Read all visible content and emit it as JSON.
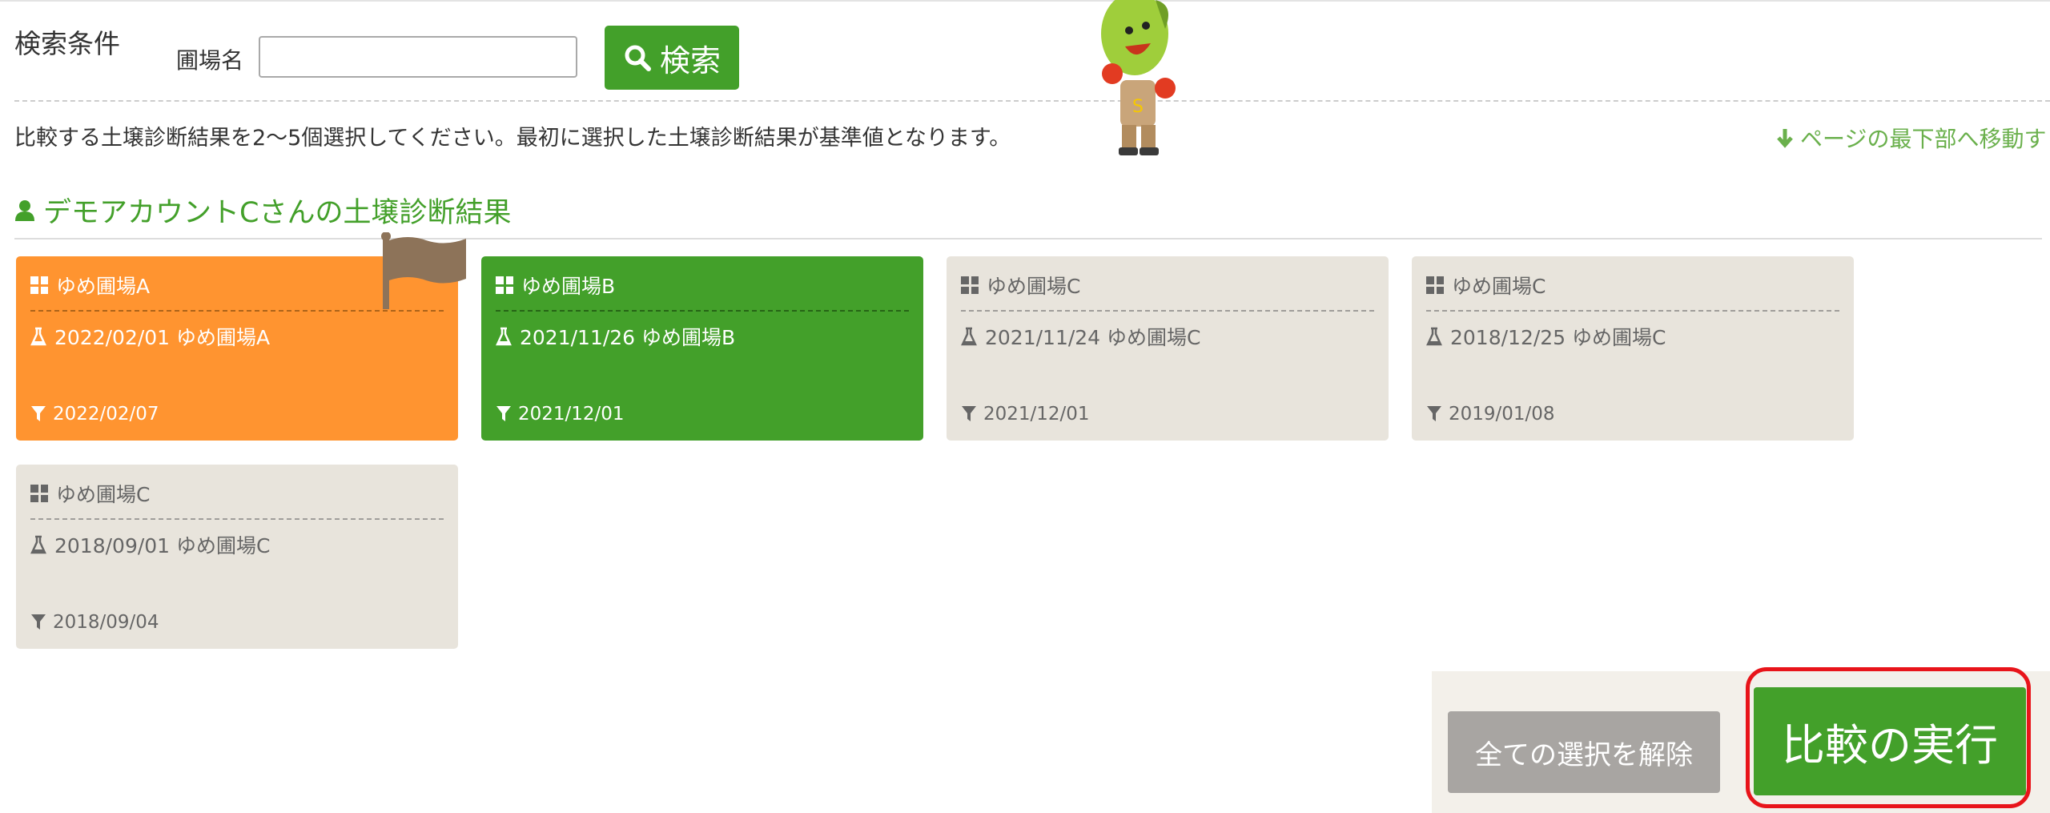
{
  "search": {
    "heading": "検索条件",
    "field_label": "圃場名",
    "input_value": "",
    "button_label": "検索"
  },
  "instruction": "比較する土壌診断結果を2〜5個選択してください。最初に選択した土壌診断結果が基準値となります。",
  "jump_link": "ページの最下部へ移動す",
  "owner_heading": "デモアカウントCさんの土壌診断結果",
  "cards": [
    {
      "field": "ゆめ圃場A",
      "diagnosis": "2022/02/01 ゆめ圃場A",
      "date": "2022/02/07",
      "state": "selected-first"
    },
    {
      "field": "ゆめ圃場B",
      "diagnosis": "2021/11/26 ゆめ圃場B",
      "date": "2021/12/01",
      "state": "selected"
    },
    {
      "field": "ゆめ圃場C",
      "diagnosis": "2021/11/24 ゆめ圃場C",
      "date": "2021/12/01",
      "state": "unselected"
    },
    {
      "field": "ゆめ圃場C",
      "diagnosis": "2018/12/25 ゆめ圃場C",
      "date": "2019/01/08",
      "state": "unselected"
    },
    {
      "field": "ゆめ圃場C",
      "diagnosis": "2018/09/01 ゆめ圃場C",
      "date": "2018/09/04",
      "state": "unselected"
    }
  ],
  "actions": {
    "clear_label": "全ての選択を解除",
    "execute_label": "比較の実行"
  },
  "icons": {
    "search": "search-icon",
    "user": "user-icon",
    "field": "grid-icon",
    "diagnosis": "flask-icon",
    "date": "filter-icon",
    "jump": "arrow-down-icon",
    "base_marker": "flag-icon"
  },
  "colors": {
    "accent_green": "#43a02a",
    "selected_first": "#ff9430",
    "unselected": "#e8e4dc",
    "highlight_red": "#e8141a",
    "clear_button": "#a8a5a2"
  }
}
